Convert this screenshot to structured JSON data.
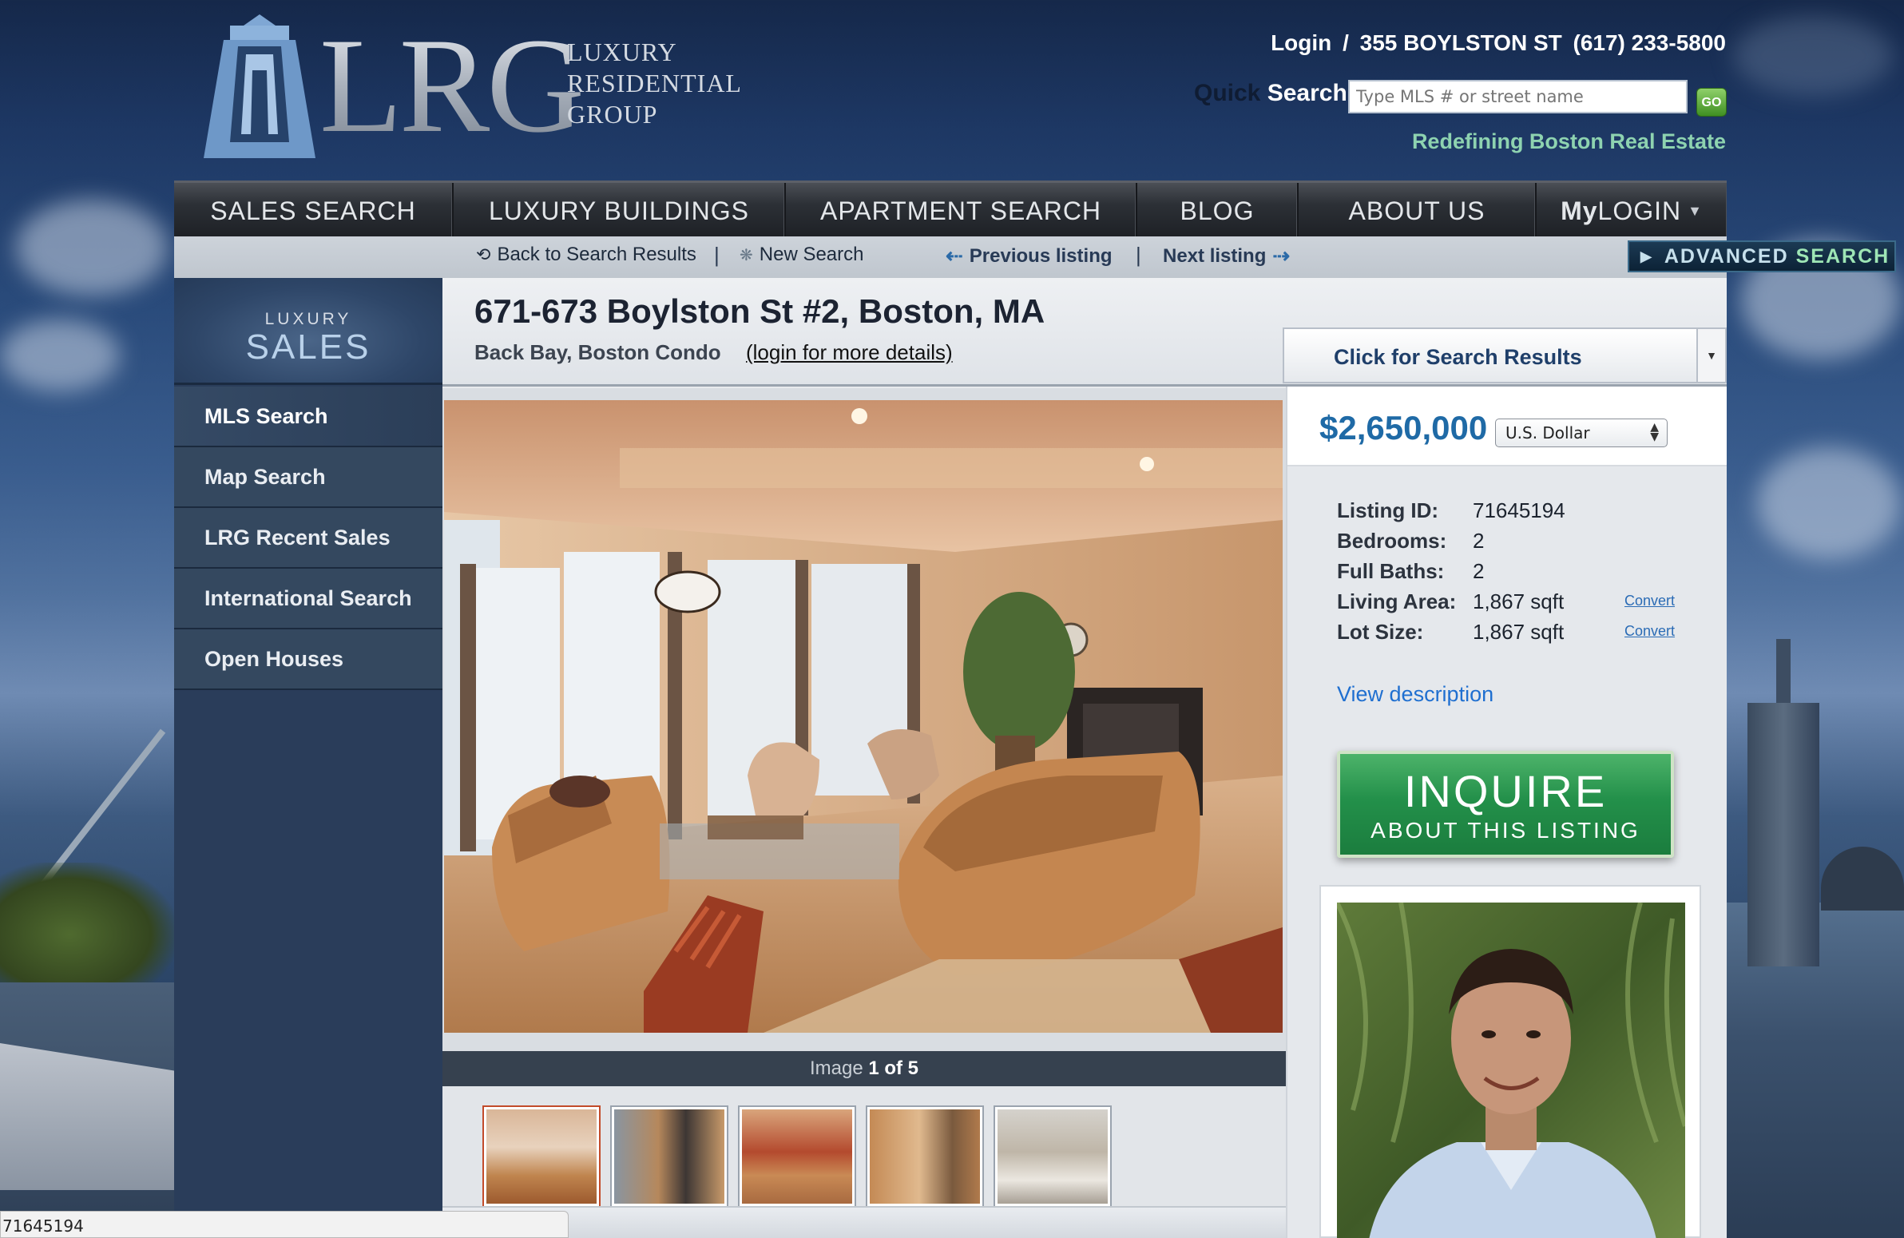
{
  "header": {
    "logo_text": "LRG",
    "logo_words": [
      "LUXURY",
      "RESIDENTIAL",
      "GROUP"
    ],
    "login_label": "Login",
    "separator": "/",
    "address": "355 BOYLSTON ST",
    "phone": "(617) 233-5800",
    "quick_search_label_1": "Quick",
    "quick_search_label_2": "Search",
    "quick_search_placeholder": "Type MLS # or street name",
    "go_label": "GO",
    "tagline": "Redefining Boston Real Estate"
  },
  "nav": {
    "items": [
      "SALES SEARCH",
      "LUXURY BUILDINGS",
      "APARTMENT SEARCH",
      "BLOG",
      "ABOUT US"
    ],
    "my_login_prefix": "My",
    "my_login_label": "LOGIN"
  },
  "subnav": {
    "back_label": "Back to Search Results",
    "sep": "|",
    "new_search_label": "New Search",
    "previous_label": "Previous listing",
    "next_label": "Next listing",
    "advanced_label_1": "ADVANCED",
    "advanced_label_2": "SEARCH"
  },
  "sidebar": {
    "header_small": "LUXURY",
    "header_big": "SALES",
    "items": [
      "MLS Search",
      "Map Search",
      "LRG Recent Sales",
      "International Search",
      "Open Houses"
    ],
    "active_index": 0
  },
  "listing": {
    "title": "671-673 Boylston St #2, Boston, MA",
    "subtitle": "Back Bay, Boston Condo",
    "login_link": "(login for more details)",
    "results_dropdown": "Click for Search Results",
    "image_caption_prefix": "Image",
    "image_caption_current": "1 of 5",
    "thumbnail_count": 5
  },
  "details": {
    "price": "$2,650,000",
    "currency": "U.S. Dollar",
    "listing_id_label": "Listing ID:",
    "listing_id": "71645194",
    "bedrooms_label": "Bedrooms:",
    "bedrooms": "2",
    "baths_label": "Full Baths:",
    "baths": "2",
    "living_area_label": "Living Area:",
    "living_area": "1,867 sqft",
    "lot_size_label": "Lot Size:",
    "lot_size": "1,867 sqft",
    "convert_label": "Convert",
    "view_description": "View description",
    "inquire_line1": "INQUIRE",
    "inquire_line2": "ABOUT THIS LISTING"
  },
  "status_bar": {
    "text": "71645194"
  },
  "colors": {
    "price_blue": "#1f6aa6",
    "inquire_green": "#23904a",
    "tagline_green": "#8ed3b0",
    "link_blue": "#1f6fd0"
  }
}
